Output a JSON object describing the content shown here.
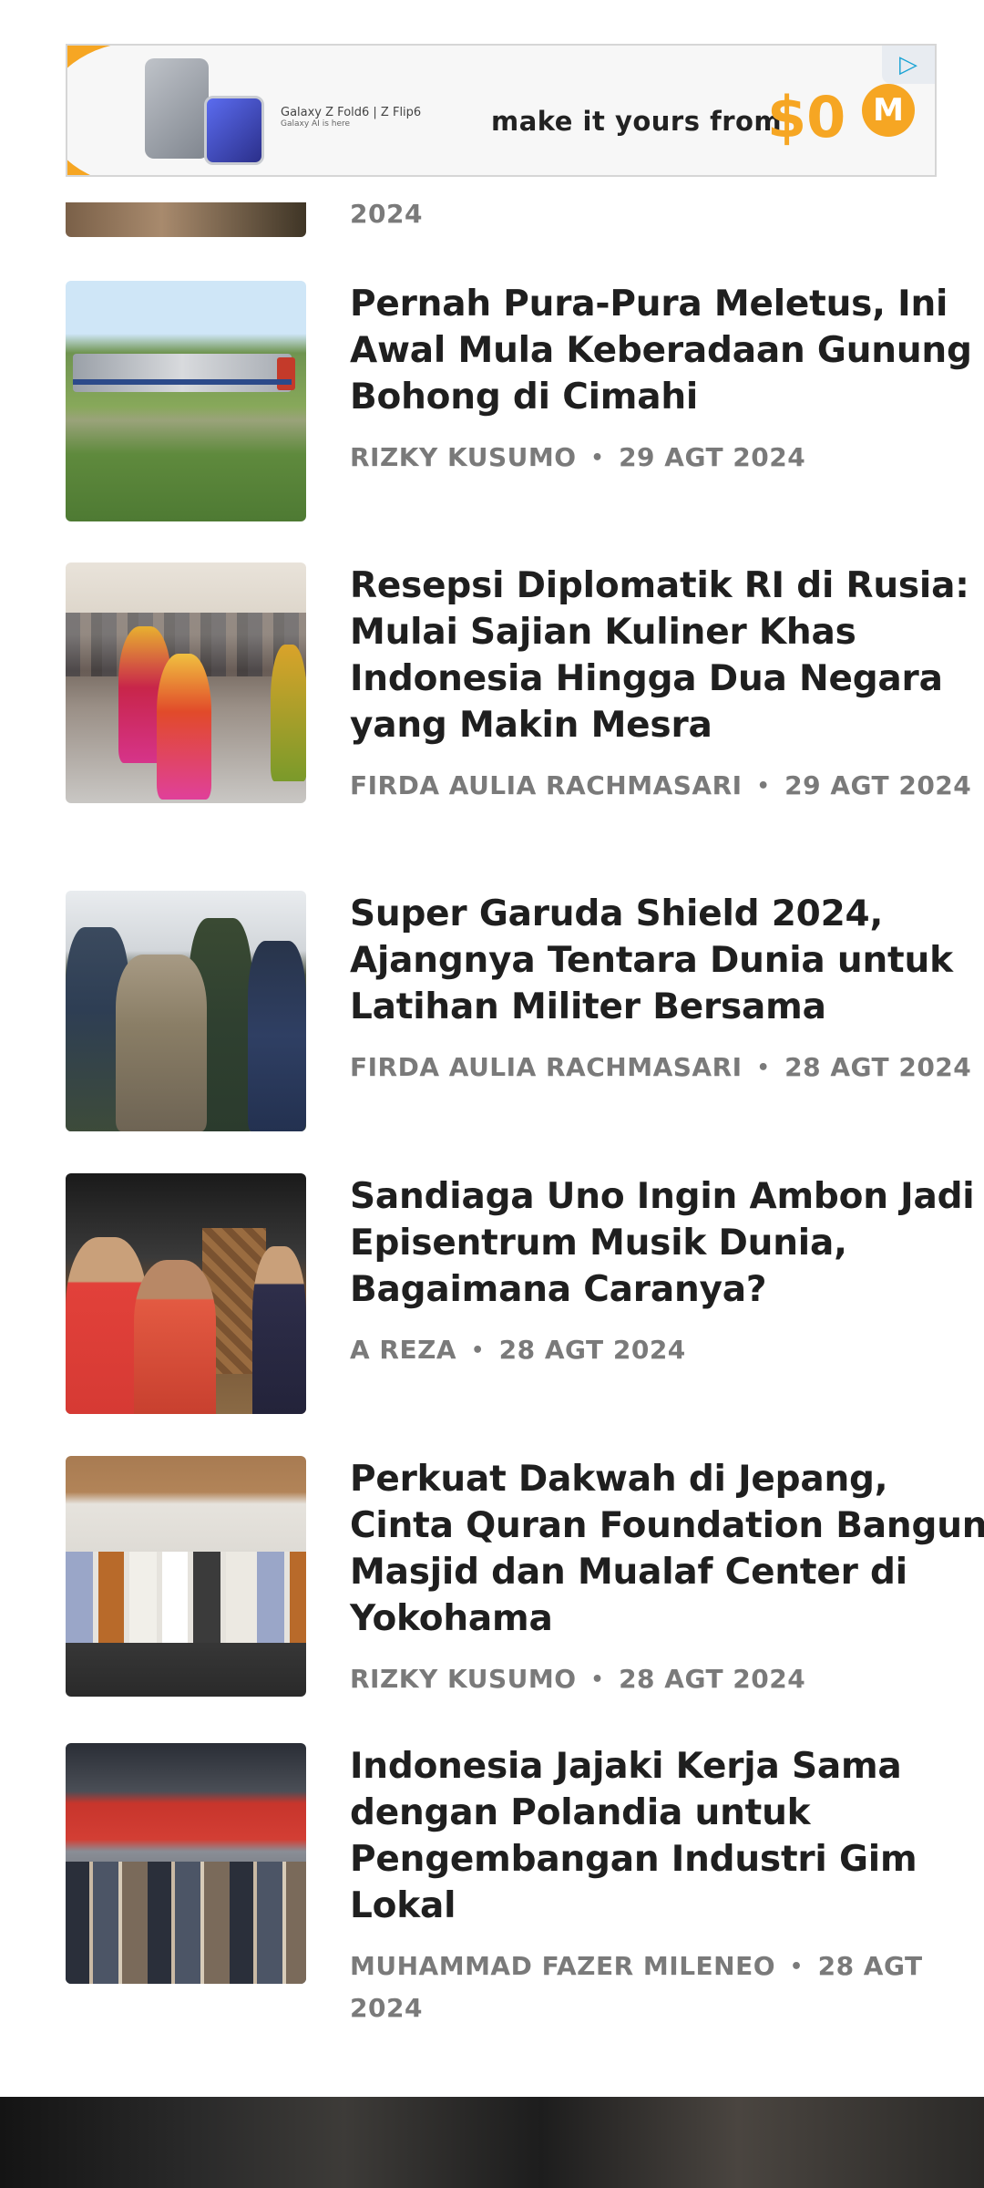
{
  "ad": {
    "model_text": "Galaxy Z Fold6 | Z Flip6",
    "model_subtext": "Galaxy AI is here",
    "tagline": "make it yours from",
    "price": "$0",
    "brand_initial": "M",
    "adchoices_icon": "adchoices-icon"
  },
  "partial_article": {
    "meta_tail": "2024"
  },
  "articles": [
    {
      "title": "Pernah Pura-Pura Meletus, Ini Awal Mula Keberadaan Gunung Bohong di Cimahi",
      "author": "RIZKY KUSUMO",
      "date": "29 AGT 2024"
    },
    {
      "title": "Resepsi Diplomatik RI di Rusia: Mulai Sajian Kuliner Khas Indonesia Hingga Dua Negara yang Makin Mesra",
      "author": "FIRDA AULIA RACHMASARI",
      "date": "29 AGT 2024"
    },
    {
      "title": "Super Garuda Shield 2024, Ajangnya Tentara Dunia untuk Latihan Militer Bersama",
      "author": "FIRDA AULIA RACHMASARI",
      "date": "28 AGT 2024"
    },
    {
      "title": "Sandiaga Uno Ingin Ambon Jadi Episentrum Musik Dunia, Bagaimana Caranya?",
      "author": "A REZA",
      "date": "28 AGT 2024"
    },
    {
      "title": "Perkuat Dakwah di Jepang, Cinta Quran Foundation Bangun Masjid dan Mualaf Center di Yokohama",
      "author": "RIZKY KUSUMO",
      "date": "28 AGT 2024"
    },
    {
      "title": "Indonesia Jajaki Kerja Sama dengan Polandia untuk Pengembangan Industri Gim Lokal",
      "author": "MUHAMMAD FAZER MILENEO",
      "date": "28 AGT 2024"
    }
  ],
  "separator": "•",
  "colors": {
    "title": "#1f1f1f",
    "meta": "#7a7a7a",
    "ad_accent": "#f6a623"
  }
}
